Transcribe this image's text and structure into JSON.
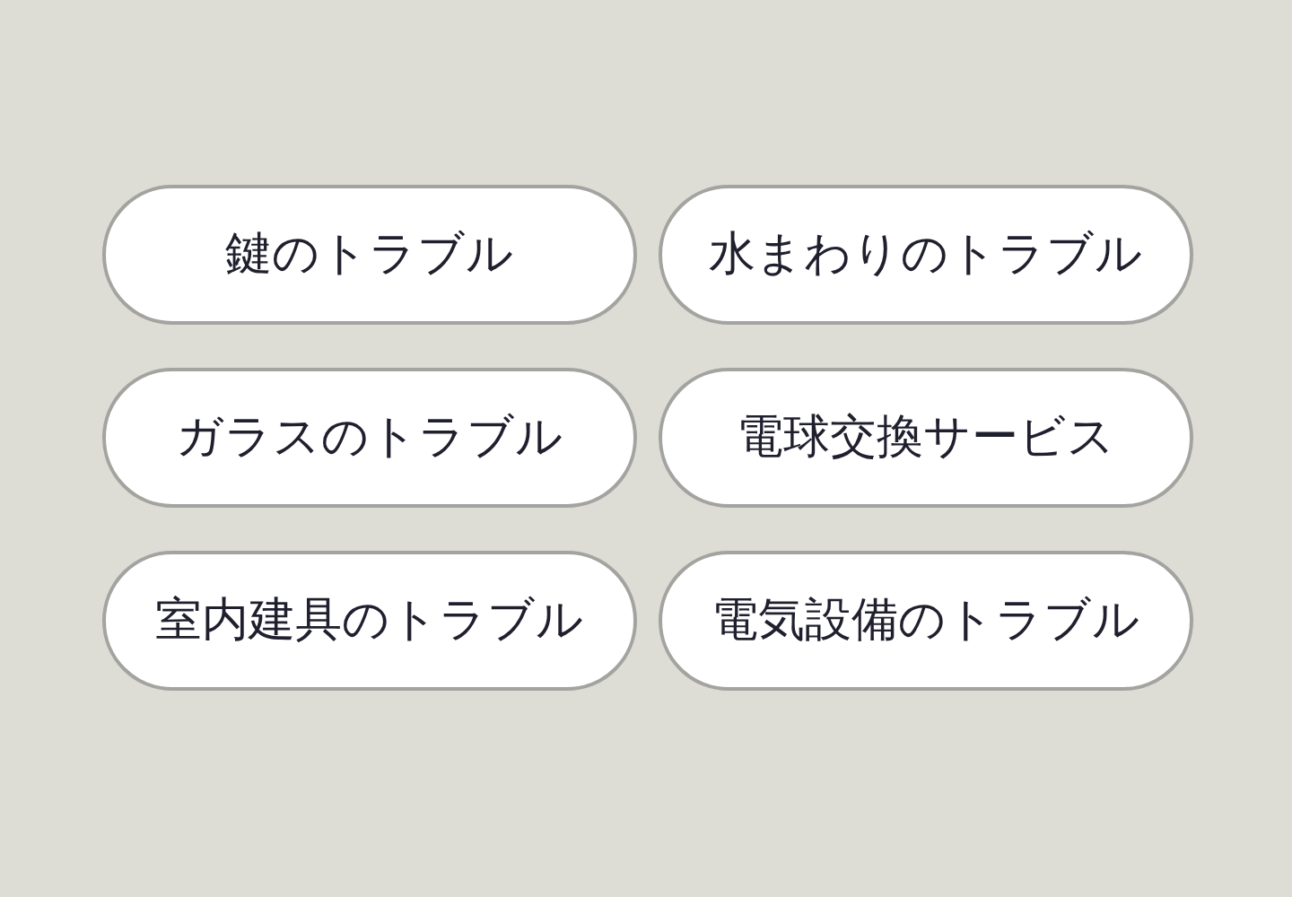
{
  "buttons": [
    {
      "label": "鍵のトラブル"
    },
    {
      "label": "水まわりのトラブル"
    },
    {
      "label": "ガラスのトラブル"
    },
    {
      "label": "電球交換サービス"
    },
    {
      "label": "室内建具のトラブル"
    },
    {
      "label": "電気設備のトラブル"
    }
  ]
}
